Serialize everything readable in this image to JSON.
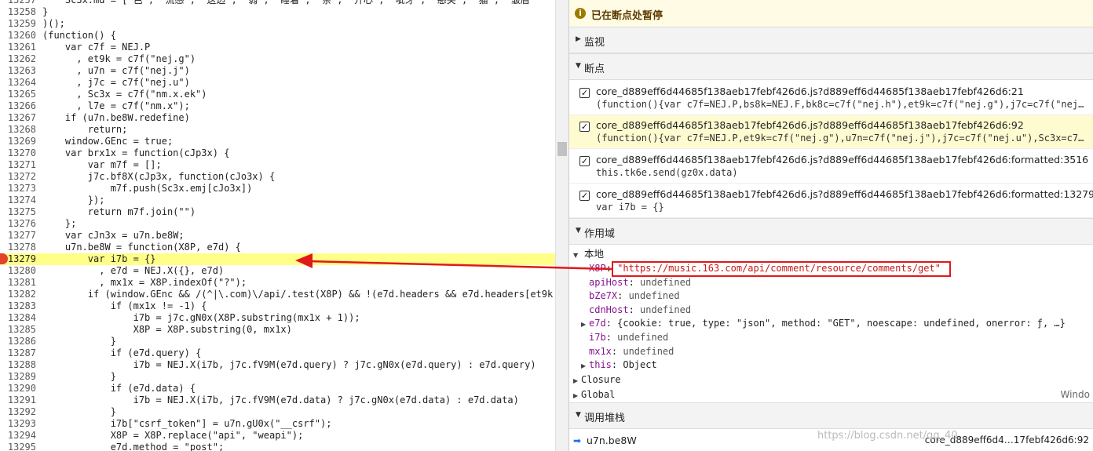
{
  "source": {
    "lines": [
      {
        "no": "13257",
        "code": "    Sc3x.md = [\"色\", \"流感\", \"这边\", \"弱\", \"睡着\", \"亲\", \"开心\", \"呲牙\", \"憨笑\", \"猫\", \"皱眉"
      },
      {
        "no": "13258",
        "code": "}"
      },
      {
        "no": "13259",
        "code": ")();"
      },
      {
        "no": "13260",
        "code": "(function() {"
      },
      {
        "no": "13261",
        "code": "    var c7f = NEJ.P"
      },
      {
        "no": "13262",
        "code": "      , et9k = c7f(\"nej.g\")"
      },
      {
        "no": "13263",
        "code": "      , u7n = c7f(\"nej.j\")"
      },
      {
        "no": "13264",
        "code": "      , j7c = c7f(\"nej.u\")"
      },
      {
        "no": "13265",
        "code": "      , Sc3x = c7f(\"nm.x.ek\")"
      },
      {
        "no": "13266",
        "code": "      , l7e = c7f(\"nm.x\");"
      },
      {
        "no": "13267",
        "code": "    if (u7n.be8W.redefine)"
      },
      {
        "no": "13268",
        "code": "        return;"
      },
      {
        "no": "13269",
        "code": "    window.GEnc = true;"
      },
      {
        "no": "13270",
        "code": "    var brx1x = function(cJp3x) {"
      },
      {
        "no": "13271",
        "code": "        var m7f = [];"
      },
      {
        "no": "13272",
        "code": "        j7c.bf8X(cJp3x, function(cJo3x) {"
      },
      {
        "no": "13273",
        "code": "            m7f.push(Sc3x.emj[cJo3x])"
      },
      {
        "no": "13274",
        "code": "        });"
      },
      {
        "no": "13275",
        "code": "        return m7f.join(\"\")"
      },
      {
        "no": "13276",
        "code": "    };"
      },
      {
        "no": "13277",
        "code": "    var cJn3x = u7n.be8W;"
      },
      {
        "no": "13278",
        "code": "    u7n.be8W = function(X8P, e7d) {"
      },
      {
        "no": "13279",
        "code": "        var i7b = {}"
      },
      {
        "no": "13280",
        "code": "          , e7d = NEJ.X({}, e7d)"
      },
      {
        "no": "13281",
        "code": "          , mx1x = X8P.indexOf(\"?\");"
      },
      {
        "no": "13282",
        "code": "        if (window.GEnc && /(^|\\.com)\\/api/.test(X8P) && !(e7d.headers && e7d.headers[et9k"
      },
      {
        "no": "13283",
        "code": "            if (mx1x != -1) {"
      },
      {
        "no": "13284",
        "code": "                i7b = j7c.gN0x(X8P.substring(mx1x + 1));"
      },
      {
        "no": "13285",
        "code": "                X8P = X8P.substring(0, mx1x)"
      },
      {
        "no": "13286",
        "code": "            }"
      },
      {
        "no": "13287",
        "code": "            if (e7d.query) {"
      },
      {
        "no": "13288",
        "code": "                i7b = NEJ.X(i7b, j7c.fV9M(e7d.query) ? j7c.gN0x(e7d.query) : e7d.query)"
      },
      {
        "no": "13289",
        "code": "            }"
      },
      {
        "no": "13290",
        "code": "            if (e7d.data) {"
      },
      {
        "no": "13291",
        "code": "                i7b = NEJ.X(i7b, j7c.fV9M(e7d.data) ? j7c.gN0x(e7d.data) : e7d.data)"
      },
      {
        "no": "13292",
        "code": "            }"
      },
      {
        "no": "13293",
        "code": "            i7b[\"csrf_token\"] = u7n.gU0x(\"__csrf\");"
      },
      {
        "no": "13294",
        "code": "            X8P = X8P.replace(\"api\", \"weapi\");"
      },
      {
        "no": "13295",
        "code": "            e7d.method = \"post\";"
      }
    ]
  },
  "sidebar": {
    "paused_text": "已在断点处暂停",
    "watch_title": "监视",
    "breakpoints_title": "断点",
    "breakpoints": [
      {
        "file": "core_d889eff6d44685f138aeb17febf426d6.js?d889eff6d44685f138aeb17febf426d6:21",
        "code": "(function(){var c7f=NEJ.P,bs8k=NEJ.F,bk8c=c7f(\"nej.h\"),et9k=c7f(\"nej.g\"),j7c=c7f(\"nej.u\"),Sc3x=c7f(\"nm.x.ek\")"
      },
      {
        "file": "core_d889eff6d44685f138aeb17febf426d6.js?d889eff6d44685f138aeb17febf426d6:92",
        "code": "(function(){var c7f=NEJ.P,et9k=c7f(\"nej.g\"),u7n=c7f(\"nej.j\"),j7c=c7f(\"nej.u\"),Sc3x=c7f(\"nm.x.ek\")"
      },
      {
        "file": "core_d889eff6d44685f138aeb17febf426d6.js?d889eff6d44685f138aeb17febf426d6:formatted:3516",
        "code": "this.tk6e.send(gz0x.data)"
      },
      {
        "file": "core_d889eff6d44685f138aeb17febf426d6.js?d889eff6d44685f138aeb17febf426d6:formatted:13279",
        "code": "var i7b = {}"
      }
    ],
    "scope_title": "作用域",
    "scope": {
      "local_label": "本地",
      "x8p_key": "X8P",
      "x8p_value": "\"https://music.163.com/api/comment/resource/comments/get\"",
      "apihost_key": "apiHost",
      "bze7x_key": "bZe7X",
      "cdnhost_key": "cdnHost",
      "undefined": "undefined",
      "e7d_key": "e7d",
      "e7d_value": "{cookie: true, type: \"json\", method: \"GET\", noescape: undefined, onerror: ƒ, …}",
      "i7b_key": "i7b",
      "mx1x_key": "mx1x",
      "this_key": "this",
      "this_value": "Object",
      "closure_label": "Closure",
      "global_label": "Global",
      "global_value": "Windo"
    },
    "callstack_title": "调用堆栈",
    "callstack": {
      "fn": "u7n.be8W",
      "location": "core_d889eff6d4…17febf426d6:92"
    },
    "watermark": "https://blog.csdn.net/qq_40..."
  }
}
